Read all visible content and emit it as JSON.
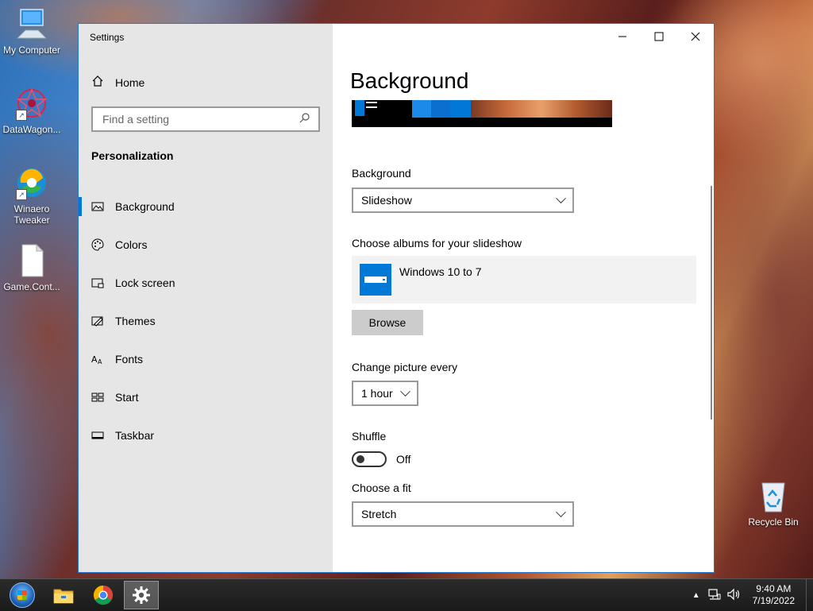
{
  "desktop": {
    "icons": [
      {
        "label": "My Computer"
      },
      {
        "label": "DataWagon..."
      },
      {
        "label": "Winaero Tweaker"
      },
      {
        "label": "Game.Cont..."
      },
      {
        "label": "Recycle Bin"
      }
    ]
  },
  "window": {
    "title": "Settings",
    "caption": {
      "minimize": "—",
      "maximize": "☐",
      "close": "✕"
    }
  },
  "sidebar": {
    "home_label": "Home",
    "search_placeholder": "Find a setting",
    "section_title": "Personalization",
    "items": [
      {
        "label": "Background",
        "icon": "picture-icon",
        "active": true
      },
      {
        "label": "Colors",
        "icon": "palette-icon"
      },
      {
        "label": "Lock screen",
        "icon": "lock-screen-icon"
      },
      {
        "label": "Themes",
        "icon": "themes-icon"
      },
      {
        "label": "Fonts",
        "icon": "fonts-icon"
      },
      {
        "label": "Start",
        "icon": "start-icon"
      },
      {
        "label": "Taskbar",
        "icon": "taskbar-icon"
      }
    ]
  },
  "main": {
    "page_title": "Background",
    "background_label": "Background",
    "background_value": "Slideshow",
    "albums_label": "Choose albums for your slideshow",
    "album_name": "Windows 10 to 7",
    "browse_label": "Browse",
    "change_label": "Change picture every",
    "change_value": "1 hour",
    "shuffle_label": "Shuffle",
    "shuffle_state": "Off",
    "fit_label": "Choose a fit",
    "fit_value": "Stretch"
  },
  "taskbar": {
    "time": "9:40 AM",
    "date": "7/19/2022"
  }
}
